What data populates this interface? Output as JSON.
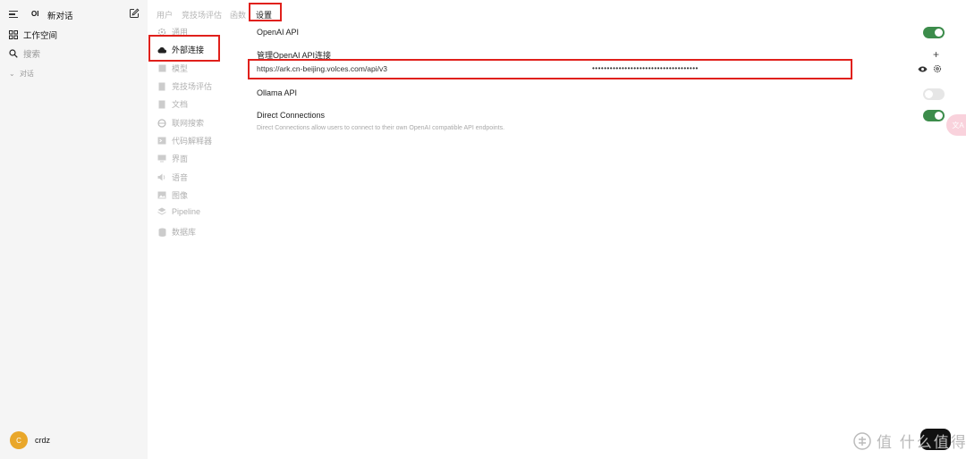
{
  "sidebar": {
    "logo": "OI",
    "new_chat": "新对话",
    "workspace": "工作空间",
    "search": "搜索",
    "chats_section": "对话",
    "user_initial": "C",
    "user_name": "crdz"
  },
  "tabs": [
    "用户",
    "竞技场评估",
    "函数",
    "设置"
  ],
  "categories": [
    {
      "label": "通用",
      "icon": "gear-icon"
    },
    {
      "label": "外部连接",
      "icon": "cloud-icon"
    },
    {
      "label": "模型",
      "icon": "cube-icon"
    },
    {
      "label": "竞技场评估",
      "icon": "document-icon"
    },
    {
      "label": "文档",
      "icon": "document-icon"
    },
    {
      "label": "联网搜索",
      "icon": "globe-icon"
    },
    {
      "label": "代码解释器",
      "icon": "terminal-icon"
    },
    {
      "label": "界面",
      "icon": "monitor-icon"
    },
    {
      "label": "语音",
      "icon": "speaker-icon"
    },
    {
      "label": "图像",
      "icon": "image-icon"
    },
    {
      "label": "Pipeline",
      "icon": "layers-icon"
    },
    {
      "label": "数据库",
      "icon": "database-icon"
    }
  ],
  "openai": {
    "title": "OpenAI API",
    "enabled": true,
    "manage_label": "管理OpenAI API连接",
    "url": "https://ark.cn-beijing.volces.com/api/v3",
    "key_mask": "••••••••••••••••••••••••••••••••••••"
  },
  "ollama": {
    "title": "Ollama API",
    "enabled": false
  },
  "direct": {
    "title": "Direct Connections",
    "enabled": true,
    "description": "Direct Connections allow users to connect to their own OpenAI compatible API endpoints."
  },
  "watermark": "值 什么值得买",
  "colors": {
    "toggle_on": "#3c8c4b",
    "highlight_box": "#e0201b",
    "avatar": "#e9a72a"
  }
}
